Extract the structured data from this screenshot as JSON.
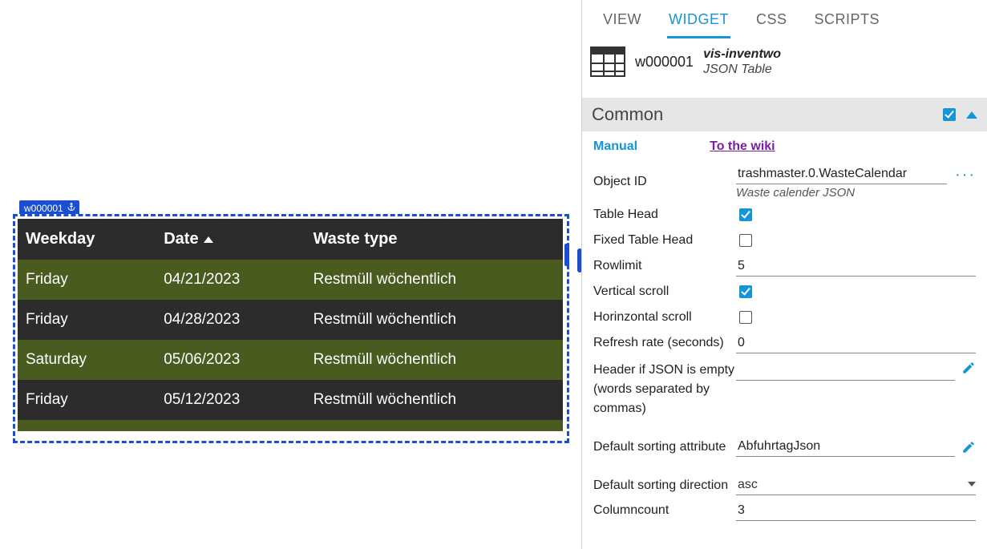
{
  "canvas": {
    "widget_tag": "w000001",
    "table": {
      "headers": [
        "Weekday",
        "Date",
        "Waste type"
      ],
      "sort_col_index": 1,
      "rows": [
        {
          "cells": [
            "Friday",
            "04/21/2023",
            "Restmüll wöchentlich"
          ],
          "cls": "row-olive"
        },
        {
          "cells": [
            "Friday",
            "04/28/2023",
            "Restmüll wöchentlich"
          ],
          "cls": "row-dark"
        },
        {
          "cells": [
            "Saturday",
            "05/06/2023",
            "Restmüll wöchentlich"
          ],
          "cls": "row-olive"
        },
        {
          "cells": [
            "Friday",
            "05/12/2023",
            "Restmüll wöchentlich"
          ],
          "cls": "row-dark"
        }
      ]
    }
  },
  "panel": {
    "tabs": {
      "view": "VIEW",
      "widget": "WIDGET",
      "css": "CSS",
      "scripts": "SCRIPTS",
      "active": "widget"
    },
    "widget_info": {
      "id": "w000001",
      "brand": "vis-inventwo",
      "type": "JSON Table"
    },
    "section_title": "Common",
    "manual_label": "Manual",
    "wiki_link": "To the wiki",
    "props": {
      "object_id": {
        "label": "Object ID",
        "value": "trashmaster.0.WasteCalendar",
        "helper": "Waste calender JSON"
      },
      "table_head": {
        "label": "Table Head",
        "checked": true
      },
      "fixed_table_head": {
        "label": "Fixed Table Head",
        "checked": false
      },
      "rowlimit": {
        "label": "Rowlimit",
        "value": "5"
      },
      "vertical_scroll": {
        "label": "Vertical scroll",
        "checked": true
      },
      "horizontal_scroll": {
        "label": "Horinzontal scroll",
        "checked": false
      },
      "refresh_rate": {
        "label": "Refresh rate (seconds)",
        "value": "0"
      },
      "header_empty": {
        "label": "Header if JSON is empty (words separated by commas)",
        "value": ""
      },
      "default_sort_attr": {
        "label": "Default sorting attribute",
        "value": "AbfuhrtagJson"
      },
      "default_sort_dir": {
        "label": "Default sorting direction",
        "value": "asc"
      },
      "columncount": {
        "label": "Columncount",
        "value": "3"
      }
    }
  }
}
